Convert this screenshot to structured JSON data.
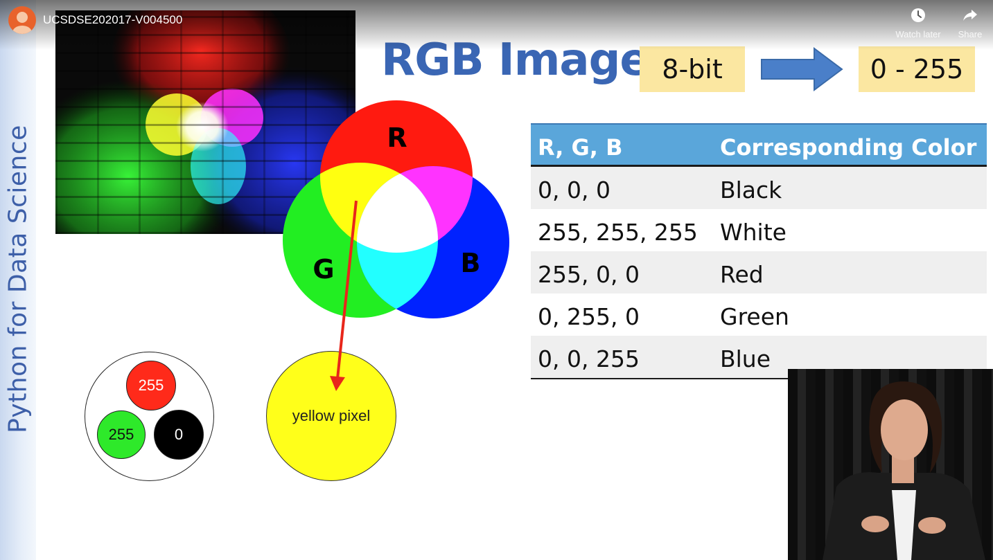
{
  "player": {
    "video_title": "UCSDSE202017-V004500",
    "actions": {
      "watch_later": "Watch later",
      "share": "Share"
    }
  },
  "slide": {
    "side_title": "Python for Data Science",
    "title": "RGB Images",
    "bit_depth_label": "8-bit",
    "range_label": "0 - 255",
    "venn_labels": {
      "red": "R",
      "green": "G",
      "blue": "B"
    },
    "pixel_values": {
      "red": "255",
      "green": "255",
      "blue": "0"
    },
    "result_label": "yellow pixel",
    "table": {
      "headers": [
        "R, G, B",
        "Corresponding Color"
      ],
      "rows": [
        [
          "0, 0, 0",
          "Black"
        ],
        [
          "255, 255, 255",
          "White"
        ],
        [
          "255, 0, 0",
          "Red"
        ],
        [
          "0, 255, 0",
          "Green"
        ],
        [
          "0, 0, 255",
          "Blue"
        ]
      ]
    }
  },
  "colors": {
    "title_blue": "#3a66b4",
    "side_text": "#3d5fa8",
    "tag_fill": "#fbe7a1",
    "arrow_blue": "#4a7fc9",
    "table_header": "#5aa6da",
    "venn_red": "#ff1a10",
    "venn_green": "#22ee22",
    "venn_blue": "#0022ff"
  }
}
